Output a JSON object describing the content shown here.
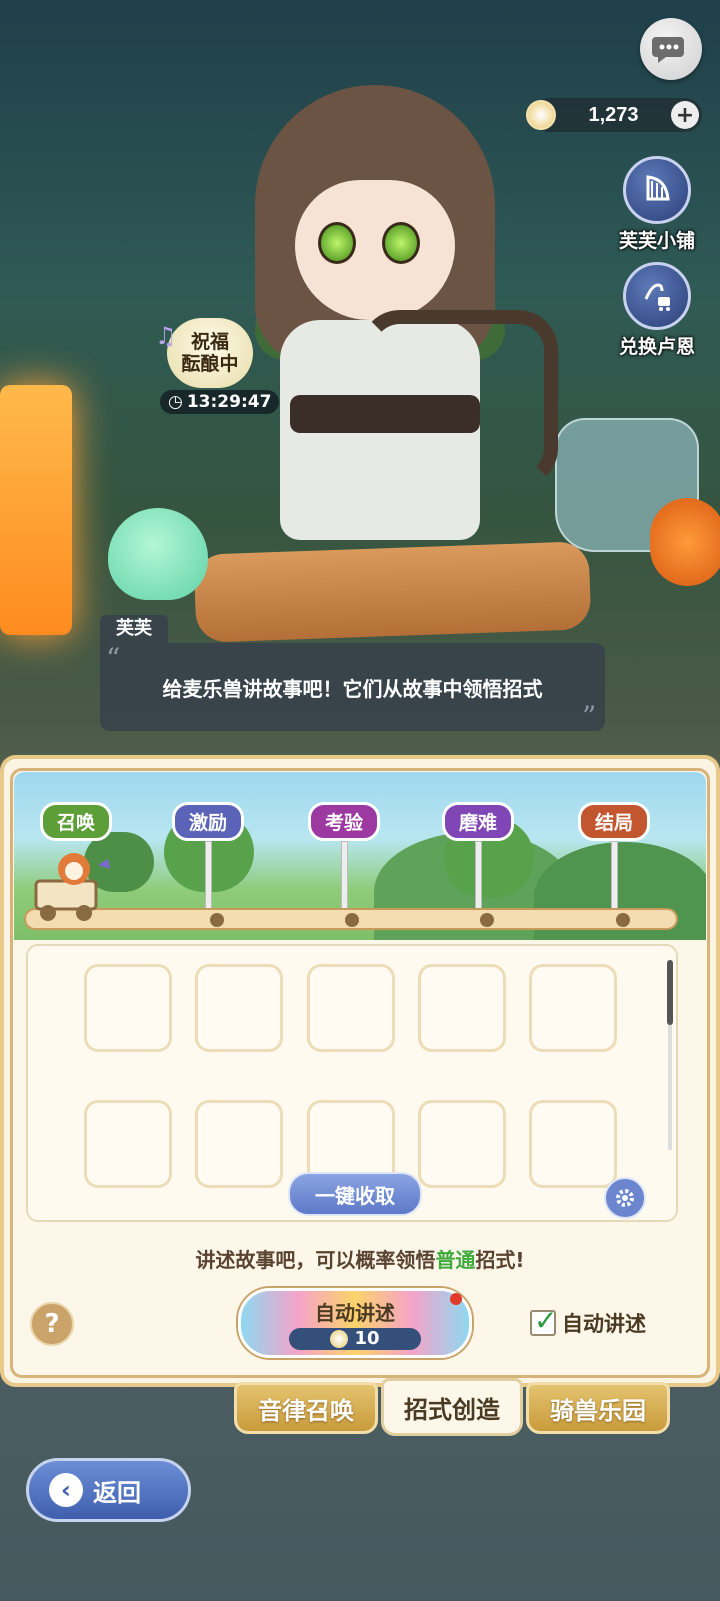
{
  "top": {
    "currency_amount": "1,273",
    "shop_label": "芙芙小铺",
    "exchange_label": "兑换卢恩"
  },
  "buff": {
    "line1": "祝福",
    "line2": "酝酿中",
    "timer": "13:29:47"
  },
  "dialogue": {
    "speaker": "芙芙",
    "text": "给麦乐兽讲故事吧！它们从故事中领悟招式"
  },
  "stages": [
    {
      "label": "召唤"
    },
    {
      "label": "激励"
    },
    {
      "label": "考验"
    },
    {
      "label": "磨难"
    },
    {
      "label": "结局"
    }
  ],
  "grid": {
    "collect_all_label": "一键收取"
  },
  "footer": {
    "hint_before": "讲述故事吧，可以概率领悟",
    "hint_highlight": "普通",
    "hint_after": "招式!",
    "auto_button_label": "自动讲述",
    "auto_cost": "10",
    "auto_checkbox_label": "自动讲述",
    "auto_checked": true
  },
  "tabs": [
    {
      "label": "音律召唤",
      "active": false
    },
    {
      "label": "招式创造",
      "active": true
    },
    {
      "label": "骑兽乐园",
      "active": false
    }
  ],
  "back_label": "返回",
  "colors": {
    "highlight_green": "#3eaa3e",
    "panel_bg": "#fdf7ea",
    "gold_border": "#e8c98a"
  }
}
